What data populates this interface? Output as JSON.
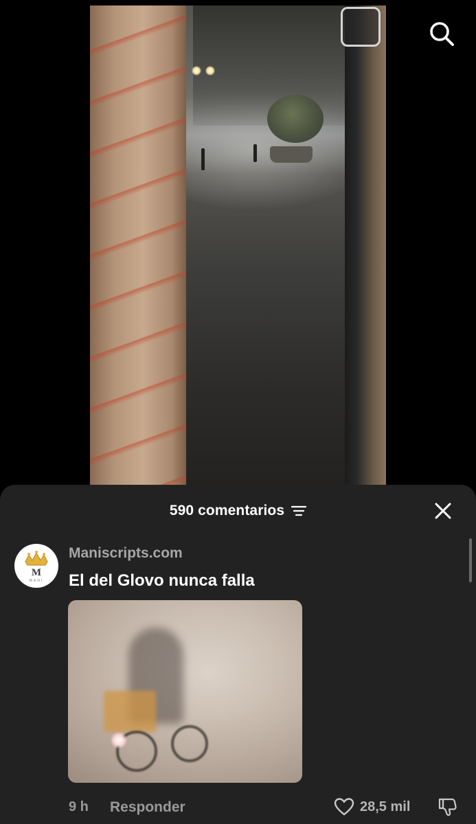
{
  "video": {
    "search_icon": "search-icon"
  },
  "comments_sheet": {
    "count_label": "590 comentarios",
    "sort_icon": "filter-sort-icon",
    "close_icon": "close-icon"
  },
  "comment": {
    "username": "Maniscripts.com",
    "avatar_icon": "crown-logo",
    "avatar_wordmark": "MANI",
    "avatar_letter": "M",
    "text": "El del Glovo nunca falla",
    "time": "9 h",
    "reply_label": "Responder",
    "like_count": "28,5 mil",
    "like_icon": "heart-icon",
    "dislike_icon": "dislike-icon"
  },
  "colors": {
    "sheet_background": "#222222",
    "username_color": "#a7a7a7",
    "meta_color": "#9a9a9a"
  }
}
